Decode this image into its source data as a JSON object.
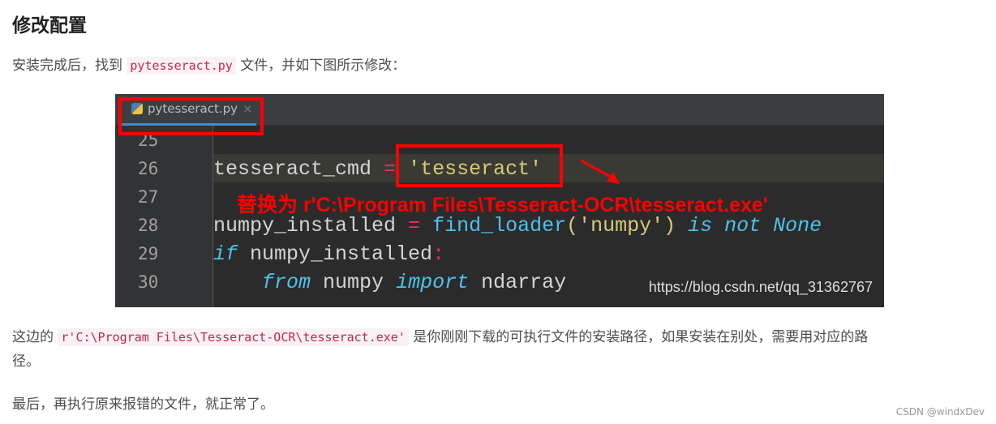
{
  "heading": "修改配置",
  "intro": {
    "before": "安装完成后，找到 ",
    "code": "pytesseract.py",
    "after": " 文件，并如下图所示修改："
  },
  "screenshot": {
    "tab_label": "pytesseract.py",
    "tab_close": "×",
    "line_numbers": [
      "25",
      "26",
      "27",
      "28",
      "29",
      "30"
    ],
    "line26": {
      "a": "tesseract_cmd ",
      "op": "=",
      "str": "'tesseract'"
    },
    "line28": {
      "a": "numpy_installed ",
      "op": "=",
      "fn": " find_loader",
      "b": "(",
      "str": "'numpy'",
      "c": ") ",
      "kw1": "is not None"
    },
    "line29": {
      "kw": "if",
      "a": " numpy_installed",
      "op": ":"
    },
    "line30": {
      "kw1": "from",
      "a": " numpy ",
      "kw2": "import",
      "b": " ndarray"
    },
    "annotation": "替换为 r'C:\\Program Files\\Tesseract-OCR\\tesseract.exe'",
    "watermark": "https://blog.csdn.net/qq_31362767"
  },
  "para2": {
    "before": "这边的 ",
    "code": "r'C:\\Program Files\\Tesseract-OCR\\tesseract.exe'",
    "after": " 是你刚刚下载的可执行文件的安装路径，如果安装在别处，需要用对应的路",
    "after2": "径。"
  },
  "para3": "最后，再执行原来报错的文件，就正常了。",
  "footer_watermark": "CSDN @windxDev",
  "colors": {
    "highlight_box": "#ff0000",
    "code_bg": "#2b2b2b"
  }
}
